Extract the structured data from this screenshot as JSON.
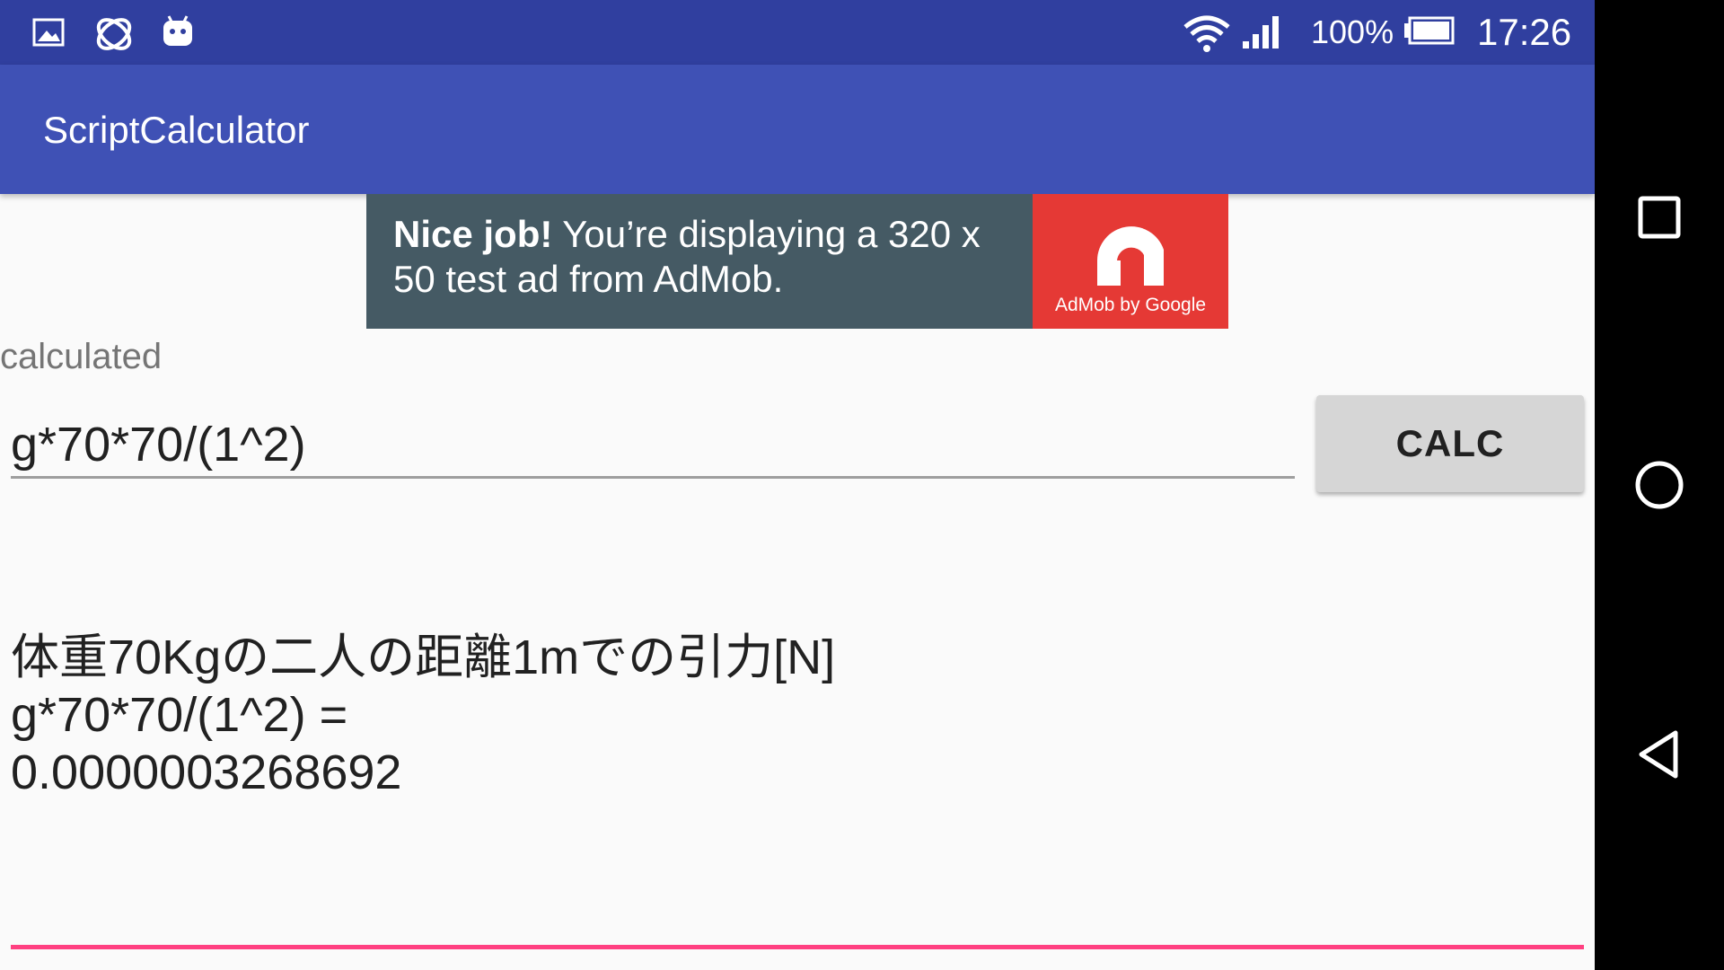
{
  "status_bar": {
    "battery_percent": "100%",
    "time": "17:26",
    "icons": [
      "image-icon",
      "sync-icon",
      "android-icon",
      "wifi-icon",
      "signal-icon",
      "battery-icon"
    ]
  },
  "app_bar": {
    "title": "ScriptCalculator"
  },
  "ad": {
    "bold_text": "Nice job!",
    "text": " You’re displaying a 320 x 50 test ad from AdMob.",
    "logo_caption": "AdMob by Google",
    "logo_color": "#e53935",
    "background_color": "#455a64"
  },
  "main": {
    "label": "calculated",
    "expression_value": "g*70*70/(1^2)",
    "calc_button_label": "CALC",
    "result_lines": [
      "体重70Kgの二人の距離1mでの引力[N]",
      "g*70*70/(1^2) =",
      "0.0000003268692"
    ],
    "accent_color": "#ff4081"
  },
  "nav_bar": {
    "buttons": [
      "recents-button",
      "home-button",
      "back-button"
    ]
  },
  "colors": {
    "status_bar": "#303f9f",
    "app_bar": "#3f51b5",
    "background": "#fafafa"
  }
}
